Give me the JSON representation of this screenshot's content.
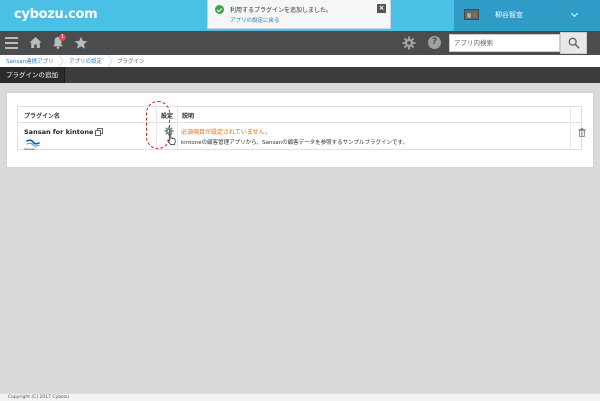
{
  "header": {
    "logo": "cybozu.com",
    "notification": {
      "message": "利用するプラグインを追加しました。",
      "link": "アプリの設定に戻る"
    },
    "user_name": "柳谷智宣"
  },
  "nav": {
    "notification_count": "1",
    "help_label": "?",
    "search_placeholder": "アプリ内検索"
  },
  "breadcrumb": [
    "Sansan連携アプリ",
    "アプリの設定",
    "プラグイン"
  ],
  "page": {
    "title_tab": "プラグインの追加"
  },
  "table": {
    "headers": {
      "name": "プラグイン名",
      "settings": "設定",
      "description": "説明"
    },
    "rows": [
      {
        "name": "Sansan for kintone",
        "logo_text": "Sansan",
        "required_message": "必須項目が設定されていません。",
        "description": "kintoneの顧客管理アプリから、Sansanの顧客データを参照するサンプルプラグインです。"
      }
    ]
  },
  "footer": {
    "copyright": "Copyright (C) 2017 Cybozu"
  },
  "colors": {
    "header_bg": "#4bc0e6",
    "nav_bg": "#4a4c4d",
    "warning_text": "#e06a1b",
    "link": "#2f7ec1",
    "highlight_ring": "#c62828"
  },
  "icons": [
    "check-circle-icon",
    "close-icon",
    "chevron-down-icon",
    "hamburger-menu-icon",
    "home-icon",
    "bell-icon",
    "star-icon",
    "gear-icon",
    "help-icon",
    "search-icon",
    "copy-icon",
    "settings-gear-icon",
    "cursor-hand-icon",
    "trash-icon"
  ]
}
